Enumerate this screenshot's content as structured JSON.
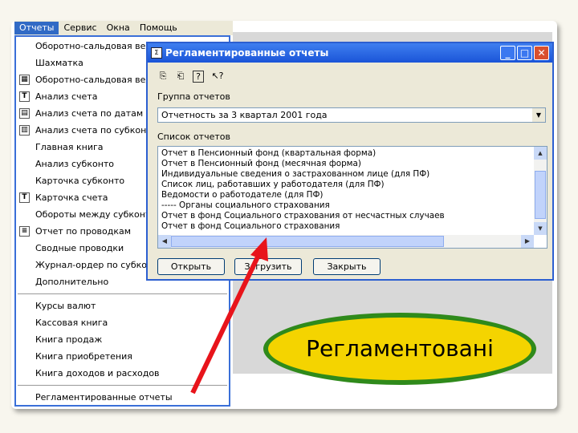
{
  "menubar": {
    "items": [
      "Отчеты",
      "Сервис",
      "Окна",
      "Помощь"
    ]
  },
  "reports_menu": {
    "items": [
      "Оборотно-сальдовая ведо",
      "Шахматка",
      "Оборотно-сальдовая веде",
      "Анализ счета",
      "Анализ счета по датам",
      "Анализ счета по субконто",
      "Главная книга",
      "Анализ субконто",
      "Карточка субконто",
      "Карточка счета",
      "Обороты между субконто",
      "Отчет по проводкам",
      "Сводные проводки",
      "Журнал-ордер по субконт",
      "Дополнительно",
      "Курсы валют",
      "Кассовая книга",
      "Книга продаж",
      "Книга приобретения",
      "Книга доходов и расходов",
      "Регламентированные отчеты"
    ]
  },
  "dialog": {
    "title": "Регламентированные отчеты",
    "group_label": "Группа отчетов",
    "group_value": "Отчетность за 3 квартал 2001 года",
    "list_label": "Список отчетов",
    "list_items": [
      "Отчет в Пенсионный фонд (квартальная форма)",
      "Отчет в Пенсионный фонд (месячная форма)",
      "Индивидуальные сведения о застрахованном лице (для ПФ)",
      "Список лиц, работавших у работодателя (для ПФ)",
      "Ведомости о работодателе (для ПФ)",
      "----- Органы социального страхования",
      "Отчет в фонд Социального страхования от несчастных случаев",
      "Отчет в фонд Социального страхования"
    ],
    "buttons": {
      "open": "Открыть",
      "load": "Загрузить",
      "close": "Закрыть"
    }
  },
  "callout": {
    "text": "Регламентовані"
  },
  "colors": {
    "menu_border": "#3a6fd8",
    "titlebar": "#1a54d8",
    "callout_fill": "#f4d400",
    "callout_border": "#2f8a1b",
    "arrow": "#e8141b"
  }
}
